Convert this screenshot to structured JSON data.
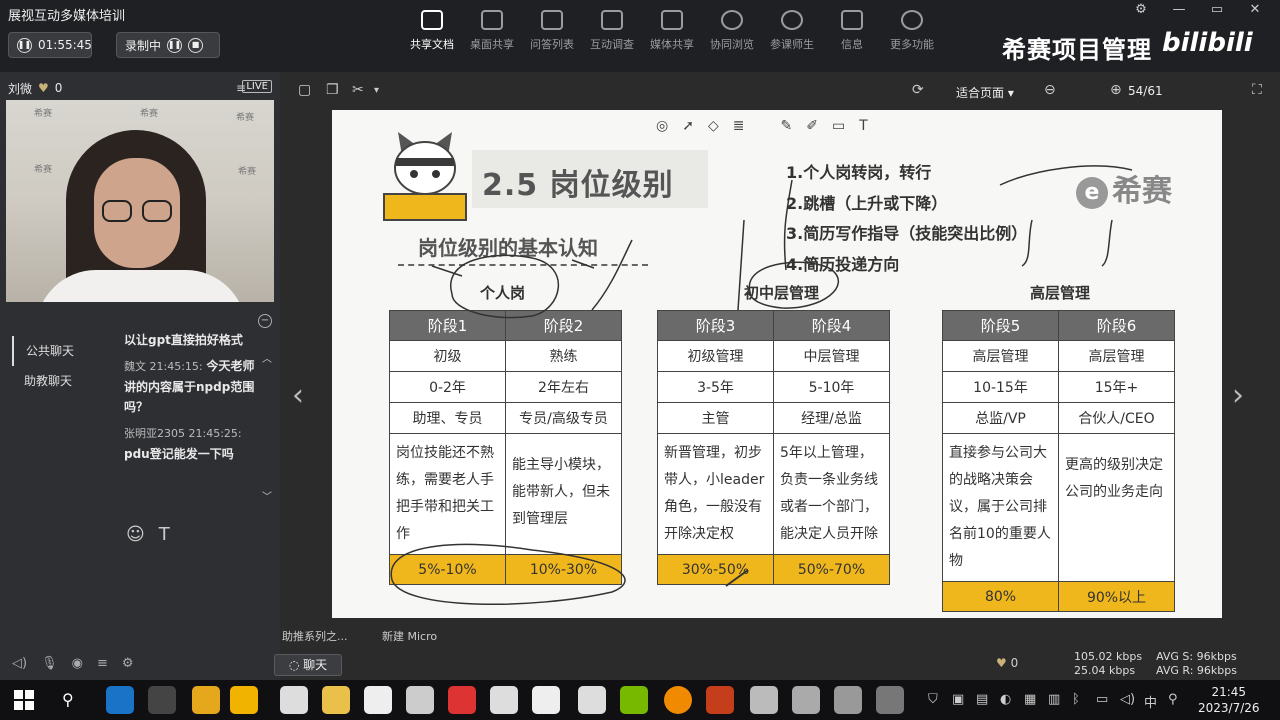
{
  "app": {
    "title": "展视互动多媒体培训",
    "session_time": "01:55:45",
    "record_label": "录制中"
  },
  "toolbar": {
    "items": [
      "共享文档",
      "桌面共享",
      "问答列表",
      "互动调查",
      "媒体共享",
      "协同浏览",
      "参课师生",
      "信息",
      "更多功能"
    ],
    "active": "共享文档"
  },
  "brand": {
    "name": "希赛项目管理",
    "platform": "bilibili"
  },
  "presenter": {
    "name": "刘微",
    "likes": "0",
    "live_badge": "LIVE",
    "watermark": "希赛"
  },
  "chat": {
    "tabs": [
      "公共聊天",
      "助教聊天"
    ],
    "messages": [
      {
        "meta": "",
        "text": "以让gpt直接拍好格式"
      },
      {
        "meta": "魏文 21:45:15:",
        "text": "今天老师讲的内容属于npdp范围吗？"
      },
      {
        "meta": "张明亚2305 21:45:25:",
        "text": "pdu登记能发一下吗"
      }
    ],
    "tools": [
      "☺",
      "T"
    ]
  },
  "slide_toolbar": {
    "fit": "适合页面",
    "page": "54/61"
  },
  "slide": {
    "title": "2.5 岗位级别",
    "subtitle": "岗位级别的基本认知",
    "agenda": [
      "1.个人岗转岗，转行",
      "2.跳槽（上升或下降）",
      "3.简历写作指导（技能突出比例）",
      "4.简历投递方向"
    ],
    "logo": "希赛",
    "logo_mark": "e",
    "groups": [
      {
        "label": "个人岗",
        "stages": [
          {
            "name": "阶段1",
            "level": "初级",
            "years": "0-2年",
            "role": "助理、专员",
            "desc": "岗位技能还不熟练，需要老人手把手带和把关工作",
            "pct": "5%-10%"
          },
          {
            "name": "阶段2",
            "level": "熟练",
            "years": "2年左右",
            "role": "专员/高级专员",
            "desc": "能主导小模块，能带新人，但未到管理层",
            "pct": "10%-30%"
          }
        ]
      },
      {
        "label": "初中层管理",
        "stages": [
          {
            "name": "阶段3",
            "level": "初级管理",
            "years": "3-5年",
            "role": "主管",
            "desc": "新晋管理，初步带人，小leader角色，一般没有开除决定权",
            "pct": "30%-50%"
          },
          {
            "name": "阶段4",
            "level": "中层管理",
            "years": "5-10年",
            "role": "经理/总监",
            "desc": "5年以上管理，负责一条业务线或者一个部门，能决定人员开除",
            "pct": "50%-70%"
          }
        ]
      },
      {
        "label": "高层管理",
        "stages": [
          {
            "name": "阶段5",
            "level": "高层管理",
            "years": "10-15年",
            "role": "总监/VP",
            "desc": "直接参与公司大的战略决策会议，属于公司排名前10的重要人物",
            "pct": "80%"
          },
          {
            "name": "阶段6",
            "level": "高层管理",
            "years": "15年+",
            "role": "合伙人/CEO",
            "desc": "更高的级别决定公司的业务走向",
            "pct": "90%以上"
          }
        ]
      }
    ]
  },
  "bottom": {
    "thumbs": [
      "助推系列之...",
      "新建 Micro"
    ],
    "chat_button": "聊天",
    "likes": "0",
    "net_up": "105.02 kbps",
    "net_down": "25.04 kbps",
    "avg_s": "AVG S: 96kbps",
    "avg_r": "AVG R: 96kbps"
  },
  "taskbar": {
    "time": "21:45",
    "date": "2023/7/26",
    "ime": "中"
  }
}
